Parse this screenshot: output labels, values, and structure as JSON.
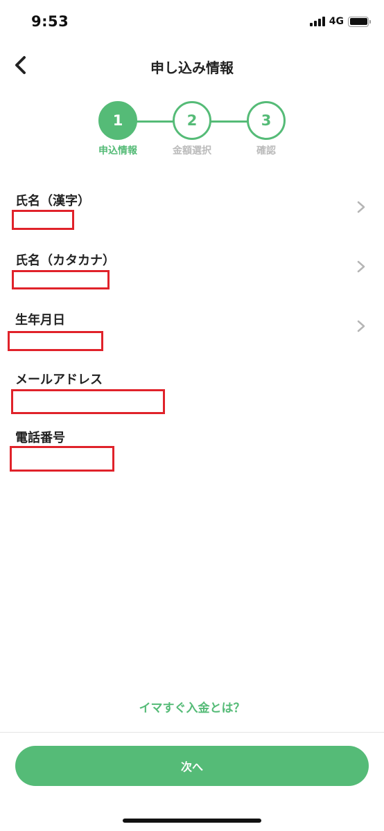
{
  "status_bar": {
    "time": "9:53",
    "network": "4G"
  },
  "header": {
    "title": "申し込み情報"
  },
  "stepper": {
    "steps": [
      {
        "number": "1",
        "label": "申込情報"
      },
      {
        "number": "2",
        "label": "金額選択"
      },
      {
        "number": "3",
        "label": "確認"
      }
    ],
    "current_step": 1
  },
  "form": {
    "fields": [
      {
        "label": "氏名（漢字）",
        "value": ""
      },
      {
        "label": "氏名（カタカナ）",
        "value": ""
      },
      {
        "label": "生年月日",
        "value": ""
      },
      {
        "label": "メールアドレス",
        "value": ""
      },
      {
        "label": "電話番号",
        "value": ""
      }
    ]
  },
  "footer": {
    "info_link": "イマすぐ入金とは？",
    "next_button": "次へ"
  },
  "colors": {
    "accent": "#55bb77",
    "redaction": "#e0222a"
  }
}
